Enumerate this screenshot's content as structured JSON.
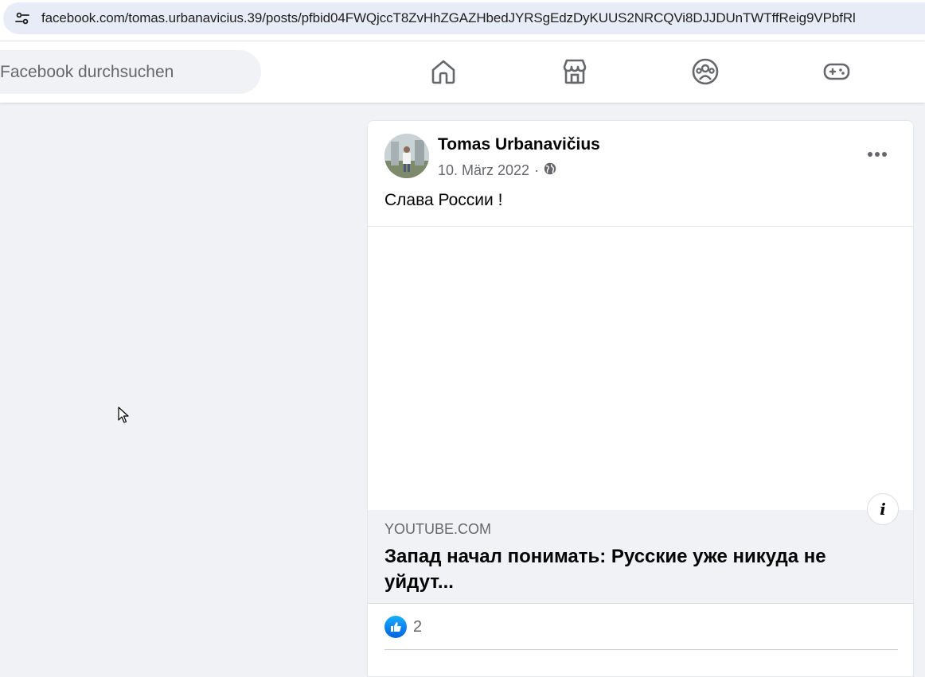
{
  "browser": {
    "url": "facebook.com/tomas.urbanavicius.39/posts/pfbid04FWQjccT8ZvHhZGAZHbedJYRSgEdzDyKUUS2NRCQVi8DJJDUnTWTffReig9VPbfRl"
  },
  "header": {
    "search_placeholder": "Facebook durchsuchen",
    "nav": [
      {
        "name": "home-icon"
      },
      {
        "name": "marketplace-icon"
      },
      {
        "name": "groups-icon"
      },
      {
        "name": "gaming-icon"
      }
    ]
  },
  "post": {
    "author": "Tomas Urbanavičius",
    "date": "10. März 2022",
    "separator": "·",
    "privacy_icon": "globe-icon",
    "text": "Слава России !",
    "link": {
      "domain": "YOUTUBE.COM",
      "title": "Запад начал понимать: Русские уже никуда не уйдут..."
    },
    "reactions": {
      "icon": "like-icon",
      "count": "2"
    }
  },
  "colors": {
    "background": "#f0f2f5",
    "text_primary": "#050505",
    "text_secondary": "#65676b",
    "like_blue": "#0866ff"
  }
}
